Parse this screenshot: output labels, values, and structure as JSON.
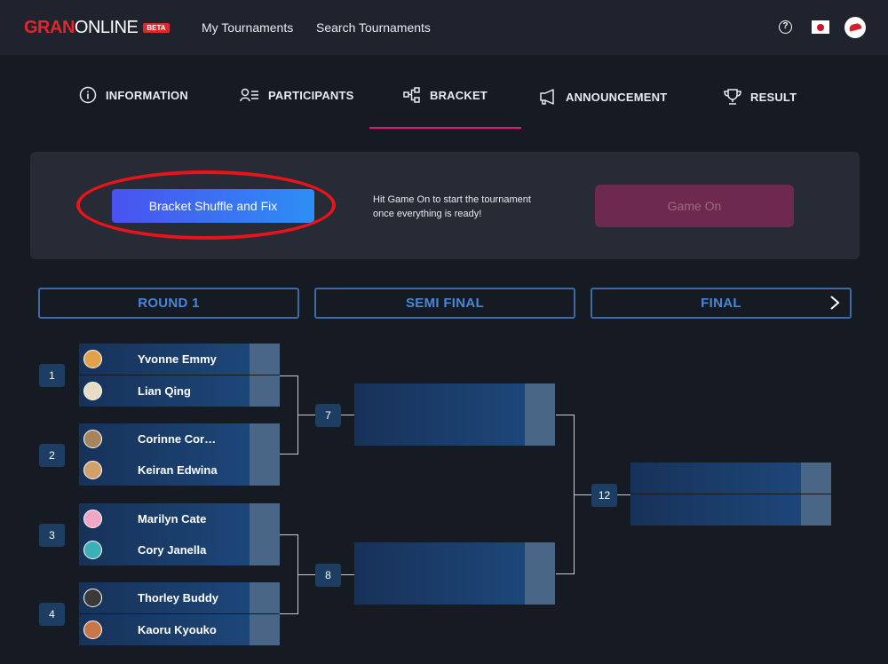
{
  "nav": {
    "logo_gran": "GRAN",
    "logo_online": "ONLINE",
    "logo_badge": "BETA",
    "links": [
      "My Tournaments",
      "Search Tournaments"
    ],
    "help_glyph": "?"
  },
  "tabs": [
    {
      "label": "INFORMATION",
      "icon": "info-icon"
    },
    {
      "label": "PARTICIPANTS",
      "icon": "participants-icon"
    },
    {
      "label": "BRACKET",
      "icon": "bracket-icon",
      "active": true
    },
    {
      "label": "ANNOUNCEMENT",
      "icon": "megaphone-icon"
    },
    {
      "label": "RESULT",
      "icon": "trophy-icon"
    }
  ],
  "panel": {
    "shuffle_label": "Bracket Shuffle and Fix",
    "hint_line1": "Hit Game On to start the tournament",
    "hint_line2": "once everything is ready!",
    "gameon_label": "Game On"
  },
  "rounds": [
    "ROUND 1",
    "SEMI FINAL",
    "FINAL"
  ],
  "matches": [
    {
      "number": "1",
      "players": [
        "Yvonne Emmy",
        "Lian Qing"
      ]
    },
    {
      "number": "2",
      "players": [
        "Corinne Cor…",
        "Keiran Edwina"
      ]
    },
    {
      "number": "3",
      "players": [
        "Marilyn Cate",
        "Cory Janella"
      ]
    },
    {
      "number": "4",
      "players": [
        "Thorley Buddy",
        "Kaoru Kyouko"
      ]
    }
  ],
  "semi_matches": [
    "7",
    "8"
  ],
  "final_match": "12",
  "colors": {
    "accent_pink": "#e8167c",
    "brand_red": "#e0262e",
    "round_header_blue": "#4a86d6",
    "annotation_red": "#e8141a"
  }
}
